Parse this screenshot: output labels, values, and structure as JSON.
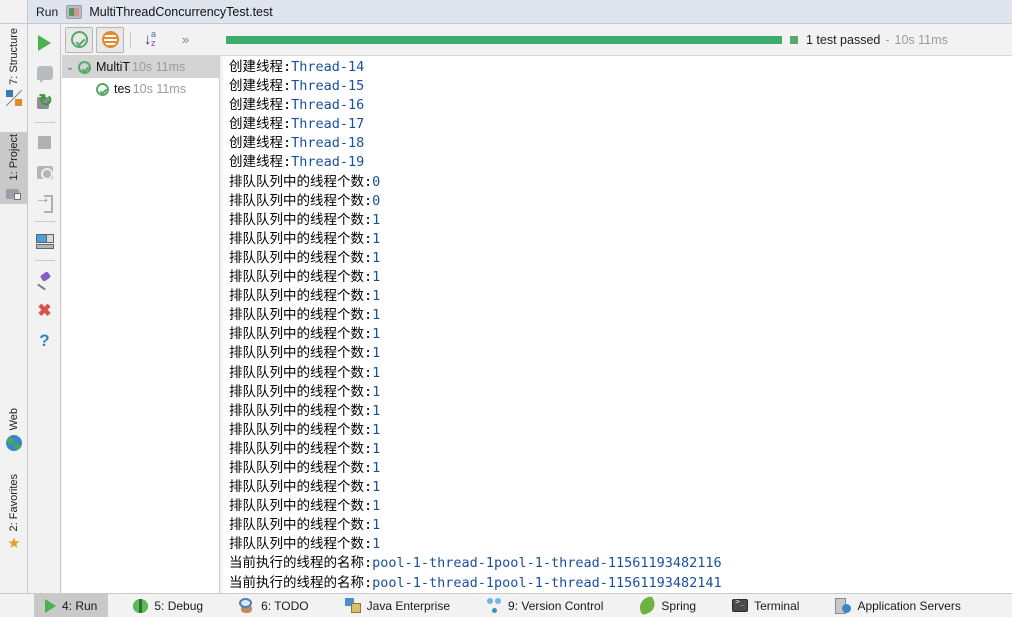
{
  "titlebar": {
    "run_label": "Run",
    "tab_icon": "run-config-icon",
    "title": "MultiThreadConcurrencyTest.test"
  },
  "left_strip": {
    "items": [
      {
        "label": "7: Structure",
        "icon": "structure-icon",
        "selected": false
      },
      {
        "label": "1: Project",
        "icon": "project-icon",
        "selected": true
      },
      {
        "label": "Web",
        "icon": "web-icon",
        "selected": false
      },
      {
        "label": "2: Favorites",
        "icon": "star-icon",
        "selected": false
      }
    ]
  },
  "run_actions": {
    "items": [
      {
        "name": "rerun-button",
        "icon": "play-icon"
      },
      {
        "name": "rerun-failed-tests-button",
        "icon": "rerun-failed-icon"
      },
      {
        "name": "toggle-auto-test-button",
        "icon": "rerun-auto-icon"
      },
      {
        "name": "stop-button",
        "icon": "stop-icon"
      },
      {
        "name": "screenshot-button",
        "icon": "camera-icon"
      },
      {
        "name": "export-button",
        "icon": "export-icon"
      },
      {
        "name": "layout-settings-button",
        "icon": "layout-icon"
      },
      {
        "name": "pin-tab-button",
        "icon": "pin-icon"
      },
      {
        "name": "close-button",
        "icon": "close-icon"
      },
      {
        "name": "help-button",
        "icon": "help-icon"
      }
    ]
  },
  "run_toolbar": {
    "buttons": [
      {
        "name": "show-passed-button",
        "icon": "check-circle-icon"
      },
      {
        "name": "show-ignored-button",
        "icon": "ignored-circle-icon"
      },
      {
        "name": "sort-alphabetically-button",
        "icon": "sort-az-icon"
      }
    ],
    "sort_arrow": "↓",
    "sort_a": "a",
    "sort_z": "z",
    "overflow_label": "»"
  },
  "test_status": {
    "progress_percent": 100,
    "progress_color": "#3cab6d",
    "result_text": "1 test passed",
    "dash": "-",
    "duration": "10s 11ms"
  },
  "test_tree": {
    "rows": [
      {
        "twisty": "⌄",
        "icon": "test-passed-icon",
        "name": "MultiT",
        "time": "10s 11ms",
        "indent": 0,
        "selected": true
      },
      {
        "twisty": "",
        "icon": "test-passed-icon",
        "name": "tes",
        "time": "10s 11ms",
        "indent": 1,
        "selected": false
      }
    ]
  },
  "console": {
    "lines": [
      {
        "text": "创建线程:Thread-14"
      },
      {
        "text": "创建线程:Thread-15"
      },
      {
        "text": "创建线程:Thread-16"
      },
      {
        "text": "创建线程:Thread-17"
      },
      {
        "text": "创建线程:Thread-18"
      },
      {
        "text": "创建线程:Thread-19"
      },
      {
        "text": "排队队列中的线程个数:0"
      },
      {
        "text": "排队队列中的线程个数:0"
      },
      {
        "text": "排队队列中的线程个数:1"
      },
      {
        "text": "排队队列中的线程个数:1"
      },
      {
        "text": "排队队列中的线程个数:1"
      },
      {
        "text": "排队队列中的线程个数:1"
      },
      {
        "text": "排队队列中的线程个数:1"
      },
      {
        "text": "排队队列中的线程个数:1"
      },
      {
        "text": "排队队列中的线程个数:1"
      },
      {
        "text": "排队队列中的线程个数:1"
      },
      {
        "text": "排队队列中的线程个数:1"
      },
      {
        "text": "排队队列中的线程个数:1"
      },
      {
        "text": "排队队列中的线程个数:1"
      },
      {
        "text": "排队队列中的线程个数:1"
      },
      {
        "text": "排队队列中的线程个数:1"
      },
      {
        "text": "排队队列中的线程个数:1"
      },
      {
        "text": "排队队列中的线程个数:1"
      },
      {
        "text": "排队队列中的线程个数:1"
      },
      {
        "text": "排队队列中的线程个数:1"
      },
      {
        "text": "排队队列中的线程个数:1"
      },
      {
        "text": "当前执行的线程的名称:pool-1-thread-1pool-1-thread-11561193482116"
      },
      {
        "text": "当前执行的线程的名称:pool-1-thread-1pool-1-thread-11561193482141"
      }
    ]
  },
  "status_bar": {
    "items": [
      {
        "label": "4: Run",
        "accel": "4",
        "icon": "run-icon",
        "selected": true
      },
      {
        "label": "5: Debug",
        "accel": "5",
        "icon": "debug-icon",
        "selected": false
      },
      {
        "label": "6: TODO",
        "accel": "6",
        "icon": "todo-icon",
        "selected": false
      },
      {
        "label": "Java Enterprise",
        "accel": "",
        "icon": "java-enterprise-icon",
        "selected": false
      },
      {
        "label": "9: Version Control",
        "accel": "9",
        "icon": "version-control-icon",
        "selected": false
      },
      {
        "label": "Spring",
        "accel": "",
        "icon": "spring-icon",
        "selected": false
      },
      {
        "label": "Terminal",
        "accel": "",
        "icon": "terminal-icon",
        "selected": false
      },
      {
        "label": "Application Servers",
        "accel": "",
        "icon": "app-servers-icon",
        "selected": false
      }
    ]
  }
}
